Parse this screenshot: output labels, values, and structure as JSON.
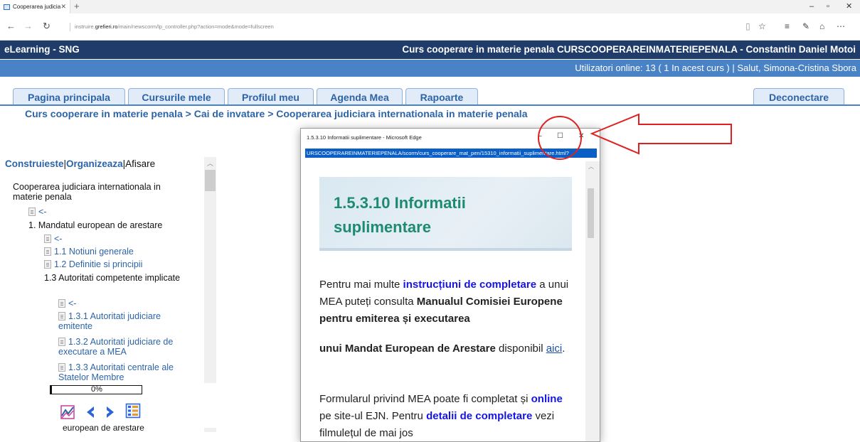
{
  "browser": {
    "tab_title": "Cooperarea judiciara int",
    "url_prefix": "instruire.",
    "url_domain": "grefieri.ro",
    "url_path": "/main/newscorm/lp_controller.php?action=mode&mode=fullscreen"
  },
  "site": {
    "app_title": "eLearning - SNG",
    "course_header": "Curs cooperare in materie penala CURSCOOPERAREINMATERIEPENALA - Constantin Daniel Motoi",
    "users_online": "Utilizatori online:  13  ( 1 In acest curs  ) | Salut, Simona-Cristina Sbora"
  },
  "nav_tabs": [
    {
      "label": "Pagina principala"
    },
    {
      "label": "Cursurile mele"
    },
    {
      "label": "Profilul meu"
    },
    {
      "label": "Agenda Mea"
    },
    {
      "label": "Rapoarte"
    }
  ],
  "logout_label": "Deconectare",
  "breadcrumb": "Curs cooperare in materie penala > Cai de invatare > Cooperarea judiciara internationala in materie penala",
  "left": {
    "mode_construct": "Construieste",
    "sep1": "|",
    "mode_organize": "Organizeaza",
    "sep2": "|",
    "mode_view": "Afisare",
    "tree": [
      {
        "label": "Cooperarea judiciara internationala in materie penala",
        "kind": "text"
      },
      {
        "label": "<-",
        "kind": "link"
      },
      {
        "label": "1. Mandatul european de arestare",
        "kind": "text"
      },
      {
        "label": "<-",
        "kind": "link"
      },
      {
        "label": "1.1 Notiuni generale",
        "kind": "link"
      },
      {
        "label": "1.2 Definitie si principii",
        "kind": "link"
      },
      {
        "label": "1.3 Autoritati competente implicate",
        "kind": "text"
      },
      {
        "label": "<-",
        "kind": "link"
      },
      {
        "label": "1.3.1 Autoritati judiciare emitente",
        "kind": "link"
      },
      {
        "label": "1.3.2 Autoritati judiciare de executare a MEA",
        "kind": "link"
      },
      {
        "label": "1.3.3 Autoritati centrale ale Statelor Membre",
        "kind": "link"
      }
    ],
    "progress_text": "0%",
    "progress_value": 0,
    "cutoff_text": "european de arestare"
  },
  "popup": {
    "window_title": "1.5.3.10 Informatii suplimentare - Microsoft Edge",
    "url": "URSCOOPERAREINMATERIEPENALA/scorm/curs_cooperare_mat_pen/15310_informatii_suplimentare.html?",
    "heading": "1.5.3.10 Informatii suplimentare",
    "p1_a": "Pentru mai multe ",
    "p1_link": "instrucțiuni de completare",
    "p1_b": " a unui MEA puteți consulta ",
    "p1_bold": "Manualul Comisiei Europene pentru emiterea și executarea",
    "p2_bold": "unui Mandat European de Arestare",
    "p2_a": " disponibil ",
    "p2_link": "aici",
    "p2_b": ".",
    "p3_a": "Formularul privind MEA poate fi completat și ",
    "p3_link1": "online",
    "p3_b": " pe site-ul EJN. Pentru ",
    "p3_link2": "detalii de completare",
    "p3_c": " vezi filmulețul de mai jos"
  },
  "colors": {
    "header_dark": "#1f3c6a",
    "header_blue": "#4a82c6",
    "link_blue": "#2d64a8",
    "heading_green": "#1f8a73",
    "annotation_red": "#e02020"
  }
}
